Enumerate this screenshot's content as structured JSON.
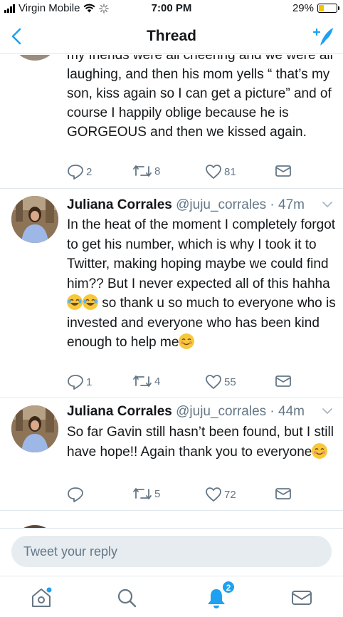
{
  "status_bar": {
    "carrier": "Virgin Mobile",
    "time": "7:00 PM",
    "battery": "29%",
    "battery_level": 0.29,
    "icons": [
      "signal-icon",
      "wifi-icon",
      "activity-icon",
      "battery-icon"
    ]
  },
  "nav": {
    "title": "Thread",
    "back_icon": "chevron-left-icon",
    "compose_icon": "compose-tweet-icon"
  },
  "tweets": [
    {
      "text": "my friends were all cheering and we were all laughing, and then his mom yells “ that’s my son, kiss again so I can get a picture” and of course I happily oblige because he is GORGEOUS and then we kissed again.",
      "replies": "2",
      "retweets": "8",
      "likes": "81"
    },
    {
      "name": "Juliana Corrales",
      "handle": "@juju_corrales",
      "time": "· 47m",
      "text_part1": "In the heat of the moment I completely forgot to get his number, which is why I took it to Twitter, making hoping maybe we could find him?? But I never expected all of this hahha",
      "text_part2": " so thank u so much to everyone who is invested and everyone who has been kind enough to help me",
      "replies": "1",
      "retweets": "4",
      "likes": "55"
    },
    {
      "name": "Juliana Corrales",
      "handle": "@juju_corrales",
      "time": "· 44m",
      "text": "So far Gavin still hasn’t been found, but I still have hope!! Again thank you to everyone",
      "replies": "",
      "retweets": "5",
      "likes": "72"
    }
  ],
  "reply_bar": {
    "placeholder": "Tweet your reply"
  },
  "tab_bar": {
    "tabs": [
      "home-icon",
      "search-icon",
      "notifications-icon",
      "messages-icon"
    ],
    "notifications_badge": "2"
  },
  "colors": {
    "accent": "#1da1f2",
    "text": "#14171a",
    "secondary": "#657786",
    "divider": "#e1e8ed"
  }
}
